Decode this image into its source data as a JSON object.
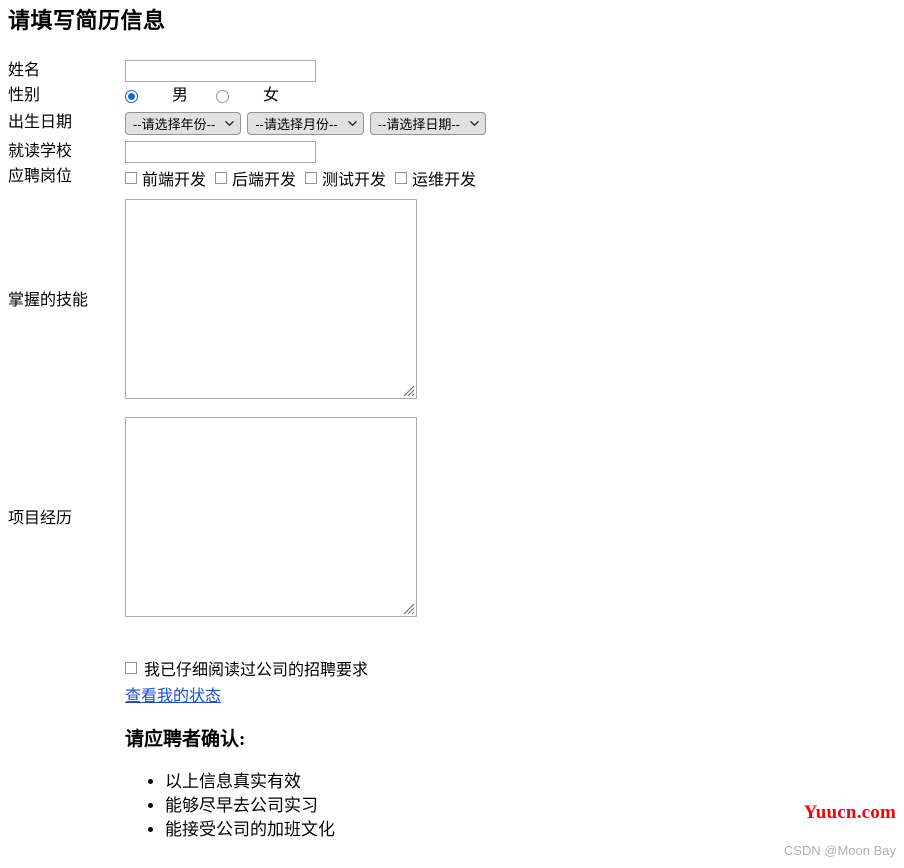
{
  "page": {
    "title": "请填写简历信息"
  },
  "form": {
    "rows": {
      "name": {
        "label": "姓名",
        "value": "",
        "placeholder": ""
      },
      "gender": {
        "label": "性别",
        "options": [
          {
            "label": "男",
            "checked": true
          },
          {
            "label": "女",
            "checked": false
          }
        ]
      },
      "birthday": {
        "label": "出生日期",
        "selects": [
          {
            "name": "year",
            "selected": "--请选择年份--"
          },
          {
            "name": "month",
            "selected": "--请选择月份--"
          },
          {
            "name": "day",
            "selected": "--请选择日期--"
          }
        ]
      },
      "school": {
        "label": "就读学校",
        "value": "",
        "placeholder": ""
      },
      "position": {
        "label": "应聘岗位",
        "options": [
          {
            "label": "前端开发",
            "checked": false
          },
          {
            "label": "后端开发",
            "checked": false
          },
          {
            "label": "测试开发",
            "checked": false
          },
          {
            "label": "运维开发",
            "checked": false
          }
        ]
      },
      "skills": {
        "label": "掌握的技能",
        "value": ""
      },
      "projects": {
        "label": "项目经历",
        "value": ""
      }
    }
  },
  "agreement": {
    "checkbox_label": "我已仔细阅读过公司的招聘要求",
    "checked": false,
    "link_text": "查看我的状态"
  },
  "confirm": {
    "title": "请应聘者确认:",
    "items": [
      "以上信息真实有效",
      "能够尽早去公司实习",
      "能接受公司的加班文化"
    ]
  },
  "watermark": {
    "site": "Yuucn.com",
    "credit": "CSDN @Moon Bay"
  },
  "colors": {
    "link": "#1a4fd6",
    "radio_accent": "#1669d8",
    "watermark_red": "#fb0007",
    "watermark_gray": "#b0b0b0",
    "select_bg": "#e1e1e1",
    "field_border": "#a9a9b4"
  }
}
